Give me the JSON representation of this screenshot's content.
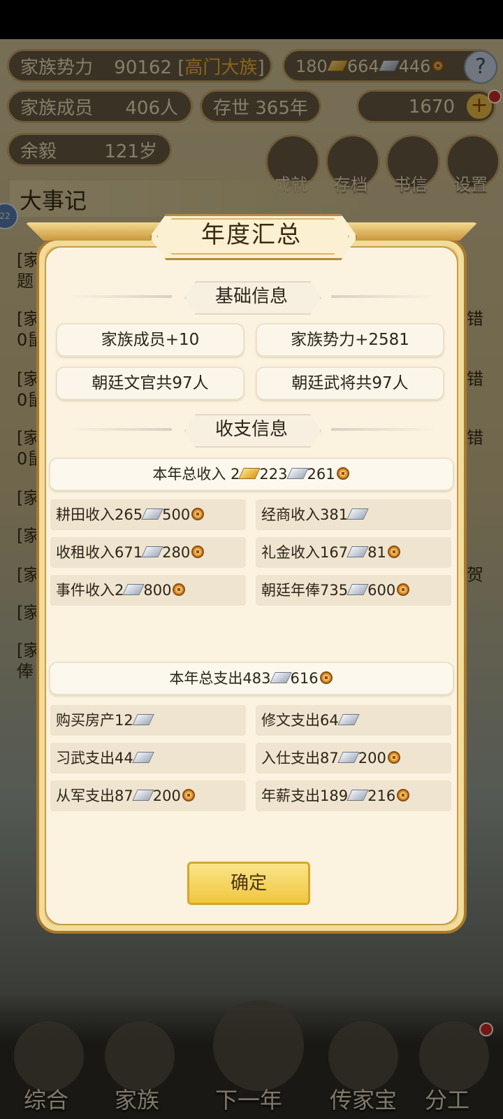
{
  "background": {
    "family_power_label": "家族势力",
    "family_power_value": "90162",
    "family_rank": "高门大族",
    "resources": {
      "gold": "180",
      "silver": "664",
      "coin": "446"
    },
    "help_label": "?",
    "members_label": "家族成员",
    "members_value": "406人",
    "existence": "存世 365年",
    "ingots": "1670",
    "remaining_label": "余毅",
    "remaining_value": "121岁",
    "round_buttons": [
      "成就",
      "存档",
      "书信",
      "设置"
    ],
    "chronicle_title": "大事记",
    "badge": "22",
    "edge_left": [
      "[家",
      "题",
      "[家",
      "0鼠",
      "[家",
      "0鼠",
      "[家",
      "0鼠",
      "[家",
      "[家",
      "[家",
      "[家",
      "[家",
      "俸"
    ],
    "edge_right": [
      "错",
      "错",
      "错",
      "贺"
    ],
    "bottom_nav": [
      "综合",
      "家族",
      "下一年",
      "传家宝",
      "分工"
    ]
  },
  "modal": {
    "title": "年度汇总",
    "basic_section": "基础信息",
    "basic_items": [
      "家族成员+10",
      "家族势力+2581",
      "朝廷文官共97人",
      "朝廷武将共97人"
    ],
    "finance_section": "收支信息",
    "income_total_label": "本年总收入 2",
    "income_total": {
      "gold": "223",
      "silver": "261"
    },
    "income_rows": [
      {
        "label": "耕田收入265",
        "mid": "500",
        "coin": true
      },
      {
        "label": "经商收入381",
        "mid": "",
        "coin": false
      },
      {
        "label": "收租收入671",
        "mid": "280",
        "coin": true
      },
      {
        "label": "礼金收入167",
        "mid": "81",
        "coin": true
      },
      {
        "label": "事件收入2",
        "mid": "800",
        "coin": true
      },
      {
        "label": "朝廷年俸735",
        "mid": "600",
        "coin": true
      }
    ],
    "expense_total_label": "本年总支出483",
    "expense_total_mid": "616",
    "expense_rows": [
      {
        "label": "购买房产12",
        "mid": "",
        "coin": false
      },
      {
        "label": "修文支出64",
        "mid": "",
        "coin": false
      },
      {
        "label": "习武支出44",
        "mid": "",
        "coin": false
      },
      {
        "label": "入仕支出87",
        "mid": "200",
        "coin": true
      },
      {
        "label": "从军支出87",
        "mid": "200",
        "coin": true
      },
      {
        "label": "年薪支出189",
        "mid": "216",
        "coin": true
      }
    ],
    "confirm_label": "确定"
  }
}
